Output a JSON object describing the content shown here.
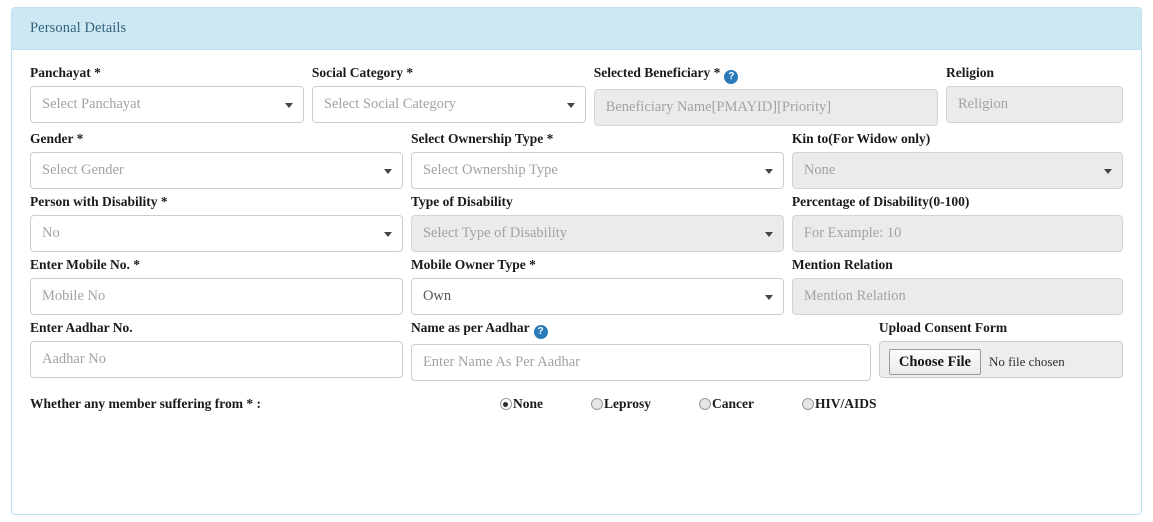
{
  "panel": {
    "title": "Personal Details",
    "header_bg": "#cde7f3",
    "border_color": "#bce0ef",
    "title_color": "#34637d"
  },
  "icons": {
    "help": "question-mark-circle",
    "help_glyph": "?",
    "help_color": "#2b7bb9"
  },
  "rows": {
    "row1": {
      "panchayat": {
        "label": "Panchayat *",
        "value": "Select Panchayat",
        "type": "select"
      },
      "social_category": {
        "label": "Social Category *",
        "value": "Select Social Category",
        "type": "select"
      },
      "selected_beneficiary": {
        "label": "Selected Beneficiary *",
        "placeholder": "Beneficiary Name[PMAYID][Priority]",
        "type": "text",
        "disabled": true
      },
      "religion": {
        "label": "Religion",
        "placeholder": "Religion",
        "type": "text",
        "disabled": true
      }
    },
    "row2": {
      "gender": {
        "label": "Gender *",
        "value": "Select Gender",
        "type": "select"
      },
      "ownership_type": {
        "label": "Select Ownership Type *",
        "value": "Select Ownership Type",
        "type": "select"
      },
      "kin_to": {
        "label": "Kin to(For Widow only)",
        "value": "None",
        "type": "select",
        "disabled": true
      }
    },
    "row3": {
      "person_with_disability": {
        "label": "Person with Disability *",
        "value": "No",
        "type": "select"
      },
      "type_of_disability": {
        "label": "Type of Disability",
        "value": "Select Type of Disability",
        "type": "select",
        "disabled": true
      },
      "percentage_of_disability": {
        "label": "Percentage of Disability(0-100)",
        "placeholder": "For Example: 10",
        "type": "text",
        "disabled": true
      }
    },
    "row4": {
      "mobile_no": {
        "label": "Enter Mobile No. *",
        "placeholder": "Mobile No",
        "type": "text"
      },
      "mobile_owner_type": {
        "label": "Mobile Owner Type *",
        "value": "Own",
        "type": "select"
      },
      "mention_relation": {
        "label": "Mention Relation",
        "placeholder": "Mention Relation",
        "type": "text",
        "disabled": true
      }
    },
    "row5": {
      "aadhar_no": {
        "label": "Enter Aadhar No.",
        "placeholder": "Aadhar No",
        "type": "text"
      },
      "name_as_per_aadhar": {
        "label": "Name as per Aadhar",
        "placeholder": "Enter Name As Per Aadhar",
        "type": "text"
      },
      "upload_consent_form": {
        "label": "Upload Consent Form",
        "button_label": "Choose File",
        "status": "No file chosen",
        "type": "file"
      }
    },
    "row6": {
      "suffering_question": "Whether any member suffering from * :",
      "options": [
        {
          "label": "None",
          "checked": true
        },
        {
          "label": "Leprosy",
          "checked": false
        },
        {
          "label": "Cancer",
          "checked": false
        },
        {
          "label": "HIV/AIDS",
          "checked": false
        }
      ]
    }
  }
}
